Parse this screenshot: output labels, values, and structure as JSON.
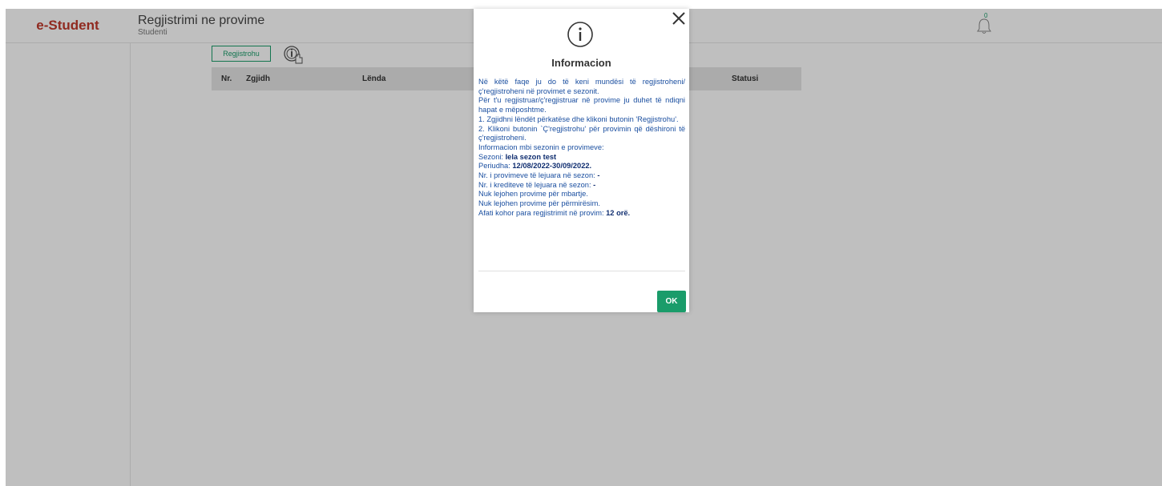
{
  "header": {
    "brand": "e-Student",
    "page_title": "Regjistrimi ne provime",
    "page_subtitle": "Studenti",
    "notification_count": "0"
  },
  "toolbar": {
    "register_label": "Regjistrohu"
  },
  "table": {
    "columns": [
      "Nr.",
      "Zgjidh",
      "Lënda",
      "Statusi"
    ]
  },
  "modal": {
    "title": "Informacion",
    "lines": [
      "Në këtë faqe ju do të keni mundësi të regjistroheni/ ç'regjistroheni në provimet e sezonit.",
      "Për t'u regjistruar/ç'regjistruar në provime ju duhet të ndiqni hapat e mëposhtme.",
      "1. Zgjidhni lëndët përkatëse dhe klikoni butonin 'Regjistrohu'.",
      "2. Klikoni butonin `Ç'regjistrohu' për provimin që dëshironi të ç'regjistroheni.",
      "Informacion mbi sezonin e provimeve:"
    ],
    "season_label": "Sezoni: ",
    "season_value": "Iela sezon test",
    "period_label": "Periudha: ",
    "period_value": "12/08/2022-30/09/2022.",
    "exams_allowed_label": "Nr. i provimeve të lejuara në sezon: ",
    "exams_allowed_value": "-",
    "credits_allowed_label": "Nr. i krediteve të lejuara në sezon: ",
    "credits_allowed_value": "-",
    "note_transfer": "Nuk lejohen provime për mbartje.",
    "note_improve": "Nuk lejohen provime për përmirësim.",
    "deadline_label": "Afati kohor para regjistrimit në provim: ",
    "deadline_value": "12 orë.",
    "ok_label": "OK"
  },
  "colors": {
    "brand": "#c0392b",
    "accent": "#1a9c6a",
    "modal_text": "#1b4fa0"
  },
  "icons": [
    "info-icon",
    "close-icon",
    "bell-icon",
    "info-hand-icon"
  ]
}
